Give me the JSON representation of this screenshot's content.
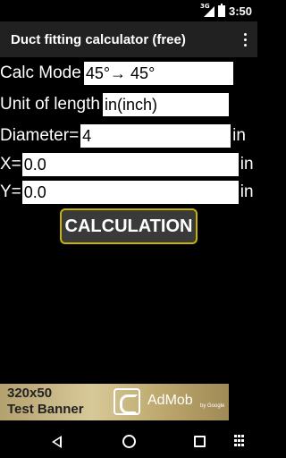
{
  "status": {
    "signal_label": "3G",
    "time": "3:50"
  },
  "appbar": {
    "title": "Duct fitting calculator (free)",
    "menu_icon": "overflow-menu-icon"
  },
  "form": {
    "calc_mode": {
      "label": "Calc Mode",
      "value": "45°→ 45°"
    },
    "unit_of_length": {
      "label": "Unit of length",
      "value": "in(inch)"
    },
    "diameter": {
      "label": "Diameter=",
      "value": "4",
      "unit": "in"
    },
    "x": {
      "label": "X=",
      "value": "0.0",
      "unit": "in"
    },
    "y": {
      "label": "Y=",
      "value": "0.0",
      "unit": "in"
    }
  },
  "calculate_button": {
    "label": "CALCULATION",
    "border_color": "#c8b400"
  },
  "ad_banner": {
    "size": "320x50",
    "label": "Test Banner",
    "brand": "AdMob",
    "by": "by Google"
  },
  "navbar": {
    "icons": [
      "back-icon",
      "home-icon",
      "recents-icon",
      "keyboard-icon"
    ]
  }
}
